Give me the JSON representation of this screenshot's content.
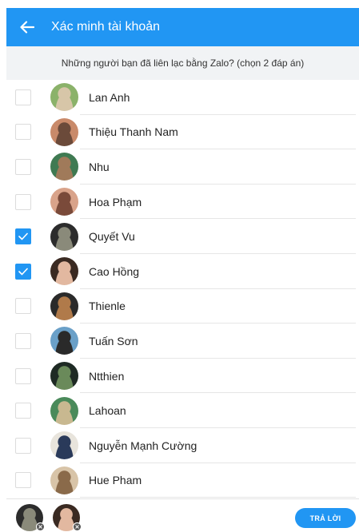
{
  "appbar": {
    "title": "Xác minh tài khoản"
  },
  "question": {
    "text": "Những người bạn đã liên lạc bằng Zalo? (chọn 2 đáp án)"
  },
  "contacts": [
    {
      "name": "Lan Anh",
      "checked": false,
      "colors": [
        "#8bb26a",
        "#d7c6a8"
      ]
    },
    {
      "name": "Thiệu Thanh Nam",
      "checked": false,
      "colors": [
        "#c98a6a",
        "#6b4a3a"
      ]
    },
    {
      "name": "Nhu",
      "checked": false,
      "colors": [
        "#3f7a52",
        "#a07a5a"
      ]
    },
    {
      "name": "Hoa Phạm",
      "checked": false,
      "colors": [
        "#d9a38a",
        "#7a4a3a"
      ]
    },
    {
      "name": "Quyết Vu",
      "checked": true,
      "colors": [
        "#2c2c2c",
        "#8a8a7a"
      ]
    },
    {
      "name": "Cao Hồng",
      "checked": true,
      "colors": [
        "#3a2a22",
        "#e2b8a0"
      ]
    },
    {
      "name": "Thienle",
      "checked": false,
      "colors": [
        "#2a2a2a",
        "#b07a4a"
      ]
    },
    {
      "name": "Tuấn Sơn",
      "checked": false,
      "colors": [
        "#6aa0c8",
        "#2a2a2a"
      ]
    },
    {
      "name": "Ntthien",
      "checked": false,
      "colors": [
        "#1e2a24",
        "#6a8a5a"
      ]
    },
    {
      "name": "Lahoan",
      "checked": false,
      "colors": [
        "#4a8a5a",
        "#c8b890"
      ]
    },
    {
      "name": "Nguyễn Mạnh Cường",
      "checked": false,
      "colors": [
        "#e8e4dc",
        "#2a3a5a"
      ]
    },
    {
      "name": "Hue Pham",
      "checked": false,
      "colors": [
        "#d8c4a8",
        "#8a6a4a"
      ]
    }
  ],
  "selected": [
    {
      "colors": [
        "#2c2c2c",
        "#8a8a7a"
      ]
    },
    {
      "colors": [
        "#3a2a22",
        "#e2b8a0"
      ]
    }
  ],
  "reply_button": {
    "label": "TRẢ LỜI"
  },
  "colors": {
    "accent": "#2196f3",
    "question_bg": "#f1f3f5"
  },
  "icons": {
    "back": "arrow-left-icon",
    "check": "check-icon",
    "remove": "close-icon"
  }
}
